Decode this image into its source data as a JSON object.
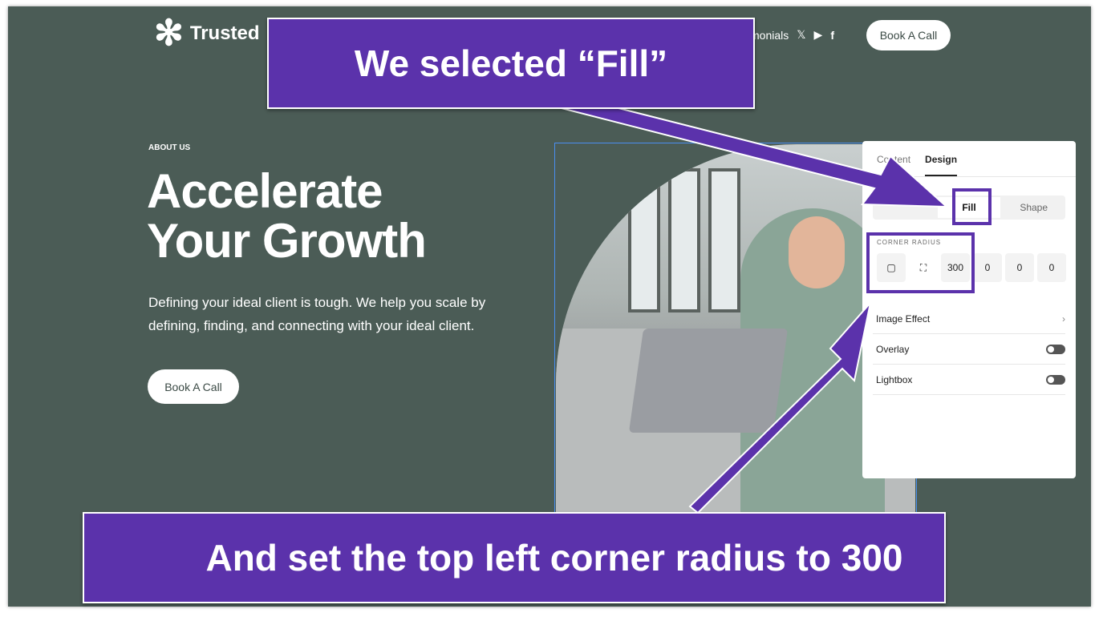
{
  "site": {
    "logo": "Trusted",
    "nav_partial": "monials",
    "social": [
      "x-icon",
      "youtube-icon",
      "facebook-icon"
    ],
    "nav_button": "Book A Call"
  },
  "hero": {
    "eyebrow": "ABOUT US",
    "title_line1": "Accelerate",
    "title_line2": "Your Growth",
    "description": "Defining your ideal client is tough. We help you scale by defining, finding, and connecting with your ideal client.",
    "button": "Book A Call"
  },
  "panel": {
    "tabs": [
      "Content",
      "Design"
    ],
    "active_tab": "Design",
    "segments": [
      "",
      "Fill",
      "Shape"
    ],
    "selected_segment": "Fill",
    "corner_radius_label": "CORNER RADIUS",
    "corner_values": [
      "300",
      "0",
      "0",
      "0"
    ],
    "rows": [
      {
        "label": "Image Effect"
      },
      {
        "label": "Overlay",
        "on": false
      },
      {
        "label": "Lightbox",
        "on": false
      }
    ]
  },
  "annotations": {
    "top": "We selected “Fill”",
    "bottom": "And set the top left corner radius to 300"
  },
  "colors": {
    "background": "#4b5c56",
    "annotation": "#5b32ab",
    "selection": "#4a8ff0"
  }
}
